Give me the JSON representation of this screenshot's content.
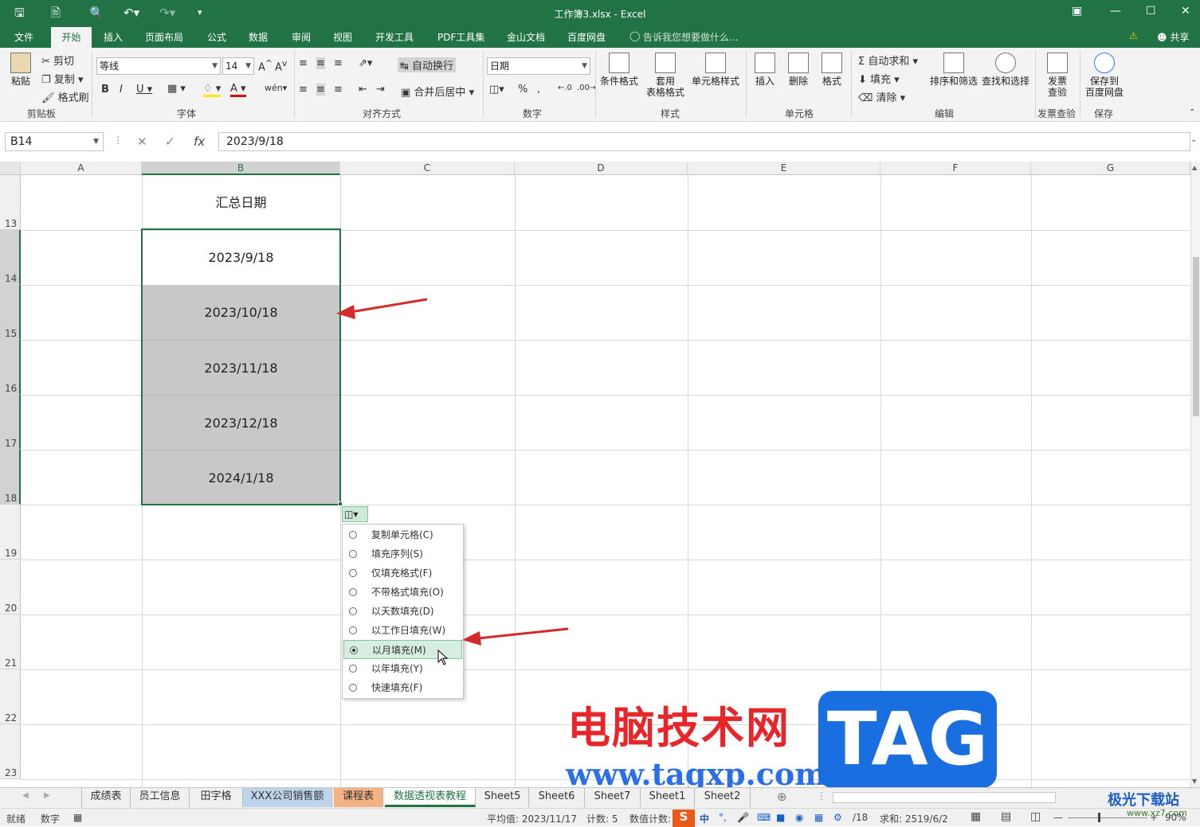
{
  "window": {
    "title": "工作簿3.xlsx - Excel"
  },
  "ribbon_tabs": [
    "文件",
    "开始",
    "插入",
    "页面布局",
    "公式",
    "数据",
    "审阅",
    "视图",
    "开发工具",
    "PDF工具集",
    "金山文档",
    "百度网盘"
  ],
  "tell_me": "告诉我您想要做什么...",
  "share": "共享",
  "clipboard": {
    "paste": "粘贴",
    "cut": "剪切",
    "copy": "复制",
    "format_painter": "格式刷",
    "group": "剪贴板"
  },
  "font": {
    "name": "等线",
    "size": "14",
    "group": "字体"
  },
  "alignment": {
    "wrap": "自动换行",
    "merge": "合并后居中",
    "group": "对齐方式"
  },
  "number": {
    "format": "日期",
    "group": "数字"
  },
  "styles": {
    "conditional": "条件格式",
    "table": "套用\n表格格式",
    "cell_styles": "单元格样式",
    "group": "样式"
  },
  "cells": {
    "insert": "插入",
    "delete": "删除",
    "format": "格式",
    "group": "单元格"
  },
  "editing": {
    "autosum": "自动求和",
    "fill": "填充",
    "clear": "清除",
    "sort": "排序和筛选",
    "find": "查找和选择",
    "group": "编辑"
  },
  "invoice": {
    "check": "发票\n查验",
    "group": "发票查验"
  },
  "save_group": {
    "save": "保存到\n百度网盘",
    "group": "保存"
  },
  "name_box": "B14",
  "formula_value": "2023/9/18",
  "columns": [
    "A",
    "B",
    "C",
    "D",
    "E",
    "F",
    "G"
  ],
  "rows": [
    "13",
    "14",
    "15",
    "16",
    "17",
    "18",
    "19",
    "20",
    "21",
    "22",
    "23"
  ],
  "cells_b": [
    "汇总日期",
    "2023/9/18",
    "2023/10/18",
    "2023/11/18",
    "2023/12/18",
    "2024/1/18"
  ],
  "autofill_menu": [
    {
      "label": "复制单元格(C)",
      "selected": false
    },
    {
      "label": "填充序列(S)",
      "selected": false
    },
    {
      "label": "仅填充格式(F)",
      "selected": false
    },
    {
      "label": "不带格式填充(O)",
      "selected": false
    },
    {
      "label": "以天数填充(D)",
      "selected": false
    },
    {
      "label": "以工作日填充(W)",
      "selected": false
    },
    {
      "label": "以月填充(M)",
      "selected": true
    },
    {
      "label": "以年填充(Y)",
      "selected": false
    },
    {
      "label": "快速填充(F)",
      "selected": false
    }
  ],
  "sheet_tabs": [
    "成绩表",
    "员工信息",
    "田字格",
    "XXX公司销售额",
    "课程表",
    "数据透视表教程",
    "Sheet5",
    "Sheet6",
    "Sheet7",
    "Sheet1",
    "Sheet2"
  ],
  "status": {
    "ready": "就绪",
    "num": "数字",
    "average": "平均值: 2023/11/17",
    "count": "计数: 5",
    "numcount": "数值计数:",
    "numcount_tail": "/18",
    "sum": "求和: 2519/6/2",
    "zoom": "90%"
  },
  "watermark": {
    "cn": "电脑技术网",
    "url": "www.tagxp.com",
    "tag": "TAG",
    "site2": "极光下载站",
    "site2_url": "www.xz7.com"
  },
  "colors": {
    "accent": "#217346",
    "selection": "#c8c8c8",
    "arrow": "#d42a2a"
  }
}
